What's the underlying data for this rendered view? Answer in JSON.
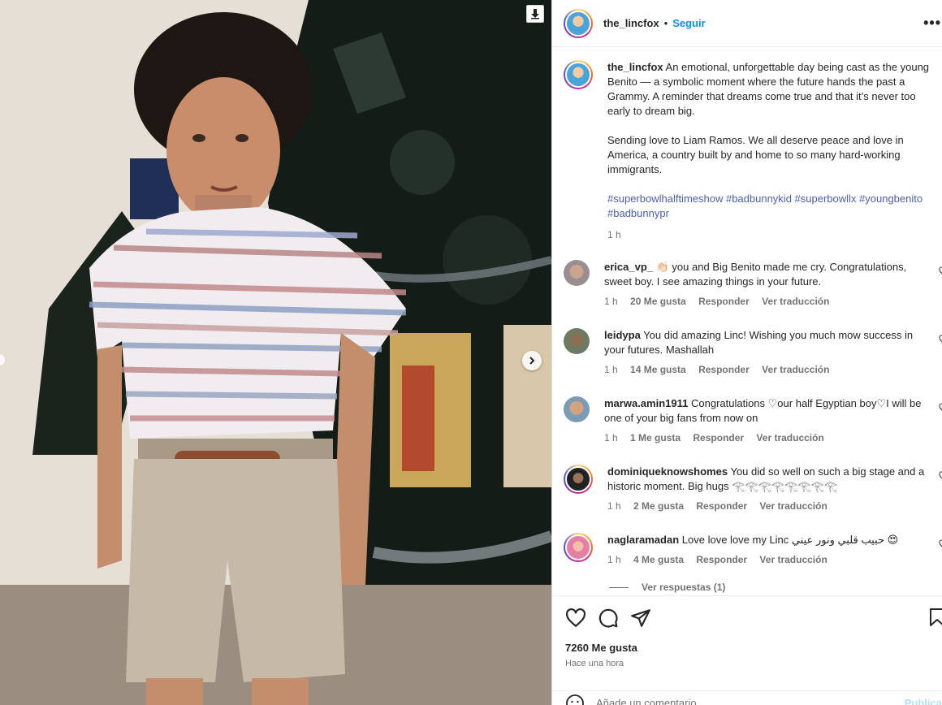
{
  "post": {
    "username": "the_lincfox",
    "follow_label": "Seguir",
    "more_label": "•••",
    "caption_p1": "An emotional, unforgettable day being cast as the young Benito — a symbolic moment where the future hands the past a Grammy. A reminder that dreams come true and that it’s never too early to dream big.",
    "caption_p2": "Sending love to Liam Ramos. We all deserve peace and love in America, a country built by and home to so many hard-working immigrants.",
    "hashtags": "#superbowlhalftimeshow #badbunnykid #superbowllx #youngbenito #badbunnypr",
    "caption_time": "1 h",
    "likes": "7260 Me gusta",
    "posted": "Hace una hora",
    "comment_placeholder": "Añade un comentario...",
    "publish_label": "Publicar"
  },
  "comments": [
    {
      "user": "erica_vp_",
      "text": "👏🏻 you and Big Benito made me cry. Congratulations, sweet boy. I see amazing things in your future.",
      "time": "1 h",
      "likes": "20 Me gusta",
      "reply": "Responder",
      "translate": "Ver traducción"
    },
    {
      "user": "leidypa",
      "text": "You did amazing Linc! Wishing you much mow success in your futures. Mashallah",
      "time": "1 h",
      "likes": "14 Me gusta",
      "reply": "Responder",
      "translate": "Ver traducción"
    },
    {
      "user": "marwa.amin1911",
      "text": "Congratulations ♡our half Egyptian boy♡I will be one of your big fans from now on",
      "time": "1 h",
      "likes": "1 Me gusta",
      "reply": "Responder",
      "translate": "Ver traducción"
    },
    {
      "user": "dominiqueknowshomes",
      "text": "You did so well on such a big stage and a historic moment. Big hugs 𓂀𓂀𓂀𓂀𓂀𓂀𓂀𓂀",
      "time": "1 h",
      "likes": "2 Me gusta",
      "reply": "Responder",
      "translate": "Ver traducción"
    },
    {
      "user": "naglaramadan",
      "text": "Love love love my Linc حبيب قلبي ونور عيني 😍",
      "time": "1 h",
      "likes": "4 Me gusta",
      "reply": "Responder",
      "translate": "Ver traducción"
    }
  ],
  "view_replies": "Ver respuestas (1)",
  "icons": {
    "download": "download-icon",
    "next": "chevron-right-icon",
    "like": "heart-icon",
    "comment": "comment-icon",
    "share": "share-icon",
    "save": "bookmark-icon",
    "emoji": "emoji-icon"
  },
  "colors": {
    "link": "#0095f6",
    "hashtag": "#4a5fb8",
    "muted": "#737373"
  }
}
